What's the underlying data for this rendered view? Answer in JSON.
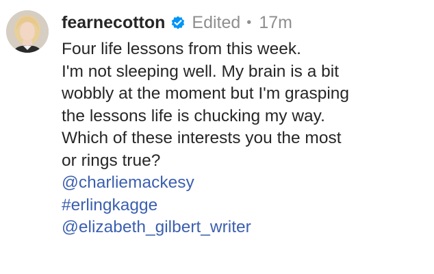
{
  "post": {
    "username": "fearnecotton",
    "verified_icon": "verified-badge-icon",
    "edited_label": "Edited",
    "separator": "•",
    "time": "17m",
    "caption_lines": [
      "Four life lessons from this week.",
      "I'm not sleeping well. My brain is a bit",
      "wobbly at the moment but I'm grasping",
      "the lessons life is chucking my way.",
      "Which of these interests you the most",
      "or rings true?"
    ],
    "tags": [
      "@charliemackesy",
      "#erlingkagge",
      "@elizabeth_gilbert_writer"
    ]
  },
  "colors": {
    "text": "#262626",
    "muted": "#8e8e8e",
    "link": "#3b5fb0",
    "verified": "#0095f6"
  }
}
